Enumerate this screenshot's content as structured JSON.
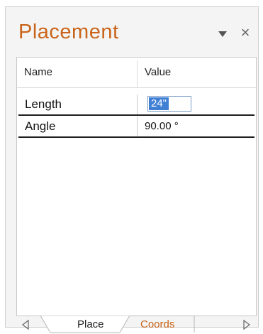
{
  "panel": {
    "title": "Placement",
    "colors": {
      "title": "#c9641a",
      "selection": "#3f7fd4"
    }
  },
  "controls": {
    "dropdown_icon": "triangle-down",
    "close_icon": "close-x",
    "close_glyph": "×"
  },
  "grid": {
    "headers": {
      "name": "Name",
      "value": "Value"
    },
    "rows": [
      {
        "name": "Length",
        "value": "24\"",
        "editing": true
      },
      {
        "name": "Angle",
        "value": "90.00 °",
        "editing": false
      }
    ]
  },
  "tabs": {
    "items": [
      {
        "label": "Place",
        "active": true
      },
      {
        "label": "Coords",
        "active": false
      }
    ],
    "left_arrow_icon": "triangle-left",
    "right_arrow_icon": "triangle-right"
  }
}
